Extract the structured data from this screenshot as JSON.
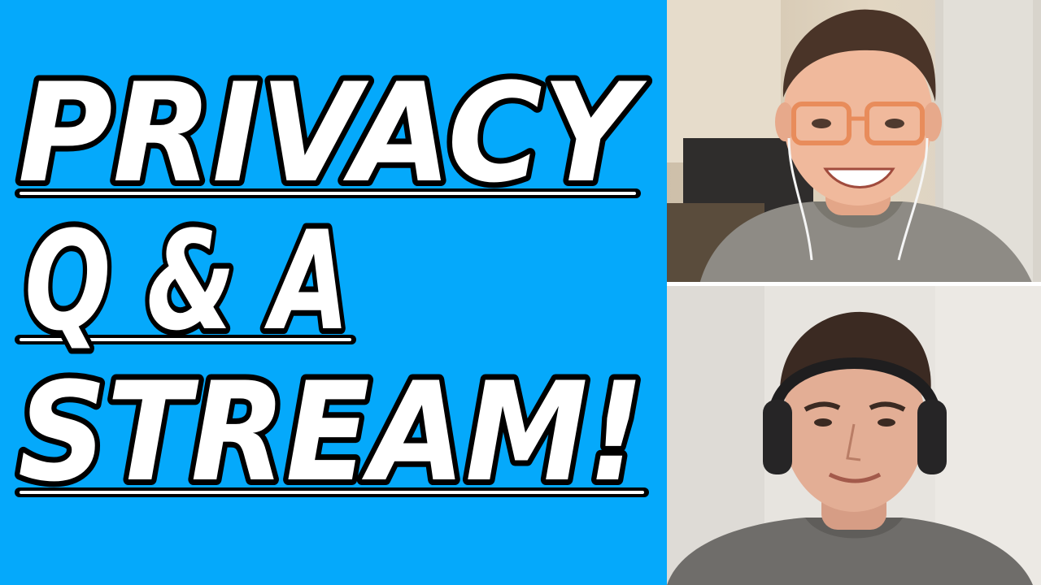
{
  "headline": {
    "lines": [
      "PRIVACY",
      "Q & A",
      "STREAM!"
    ]
  },
  "colors": {
    "background": "#05a9fb",
    "text_fill": "#ffffff",
    "text_outline": "#000000",
    "underline": "#000000"
  },
  "people": {
    "top": {
      "icon": "person-with-glasses-and-earphones",
      "shirt_color": "#8e8b85"
    },
    "bottom": {
      "icon": "person-with-headphones",
      "shirt_color": "#6f6d6a"
    }
  }
}
